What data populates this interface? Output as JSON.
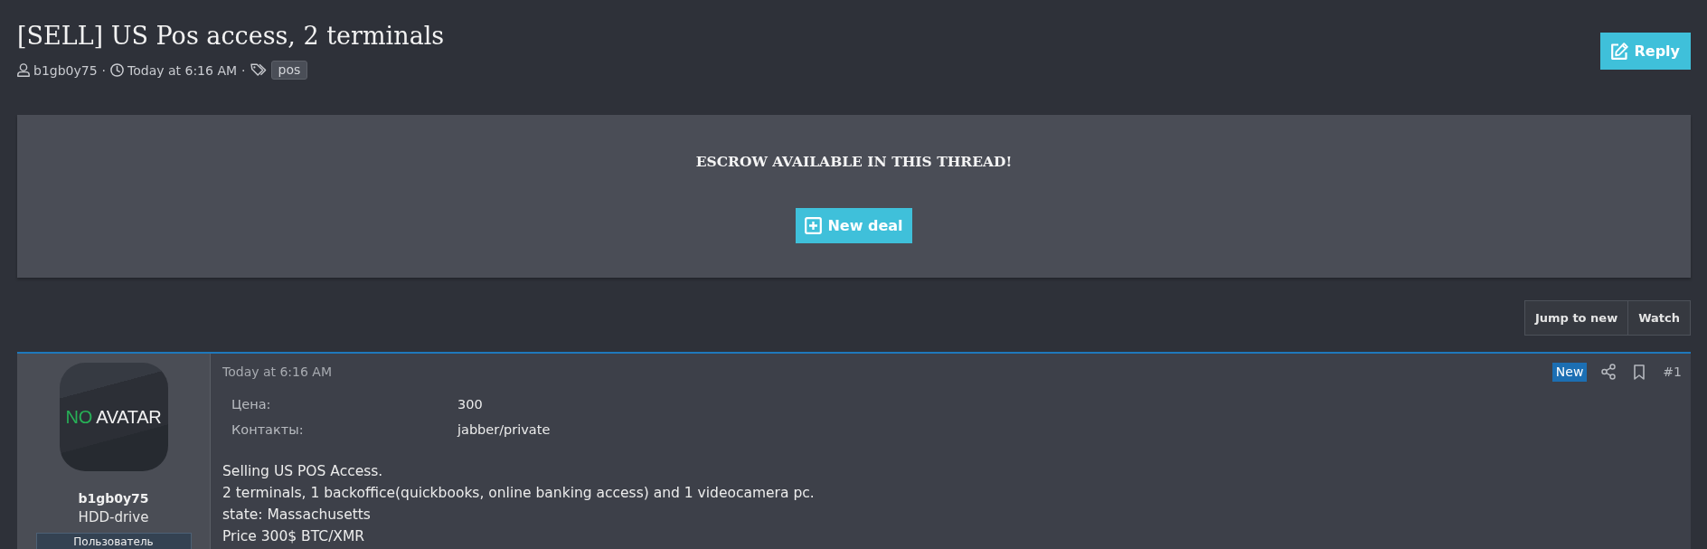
{
  "thread": {
    "title": "[SELL] US Pos access, 2 terminals",
    "meta": [
      {
        "kind": "author",
        "text": "b1gb0y75"
      },
      {
        "kind": "separator",
        "text": "·"
      },
      {
        "kind": "date",
        "text": "Today at 6:16 AM"
      },
      {
        "kind": "separator",
        "text": "·"
      },
      {
        "kind": "tags",
        "tags": [
          "pos"
        ]
      }
    ],
    "reply_button": "Reply"
  },
  "escrow": {
    "heading": "ESCROW AVAILABLE IN THIS THREAD!",
    "button": "New deal"
  },
  "thread_actions": [
    "Jump to new",
    "Watch"
  ],
  "post": {
    "author": {
      "avatar": {
        "accent": "NO",
        "text": "AVATAR"
      },
      "name": "b1gb0y75",
      "title": "HDD-drive",
      "banner": "Пользователь"
    },
    "date": "Today at 6:16 AM",
    "badge": "New",
    "number": "#1",
    "fields": [
      {
        "label": "Цена:",
        "value": "300"
      },
      {
        "label": "Контакты:",
        "value": "jabber/private"
      }
    ],
    "body": [
      "Selling US POS Access.",
      "2 terminals, 1 backoffice(quickbooks, online banking access) and 1 videocamera pc.",
      "state: Massachusetts",
      "Price 300$ BTC/XMR"
    ]
  }
}
